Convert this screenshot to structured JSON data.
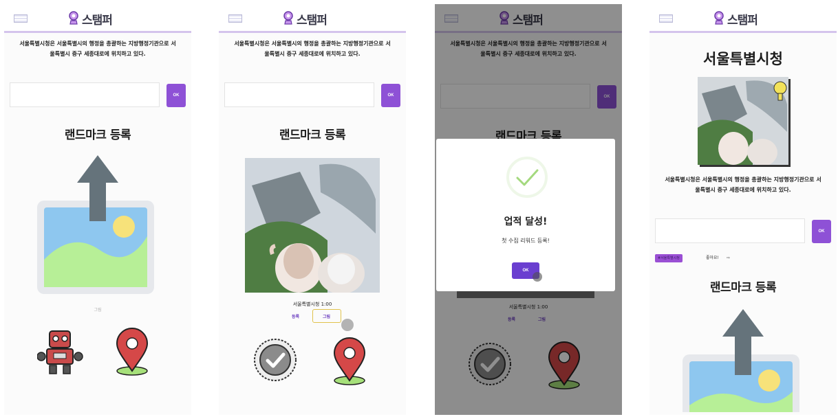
{
  "app": {
    "logo_text": "스탬퍼"
  },
  "common": {
    "description": "서울특별시청은 서울특별시의 행정을 총괄하는 지방행정기관으로 서울특별시 중구 세종대로에 위치하고 있다.",
    "ok_label": "OK",
    "register_title": "랜드마크 등록"
  },
  "screen1": {
    "caption": "그림"
  },
  "screen2": {
    "photo_label": "서울특별시청 1:00",
    "register_link": "등록",
    "retake_link": "그림"
  },
  "screen3": {
    "photo_label": "서울특별시청 1:00",
    "register_link": "등록",
    "retake_link": "그림",
    "modal": {
      "title": "업적 달성!",
      "message": "첫 수집 리워드 등록!",
      "ok_label": "OK"
    }
  },
  "screen4": {
    "landmark_name": "서울특별시청",
    "tag": "#서울특별시청",
    "like_label": "좋아요!",
    "like_arrow": "⇨"
  },
  "colors": {
    "accent": "#8e51d6",
    "header_line": "#d4c4ec"
  },
  "icons": [
    "menu-icon",
    "stamp-logo-icon",
    "upload-image-icon",
    "robot-icon",
    "map-pin-icon",
    "stamp-check-icon",
    "success-check-icon"
  ]
}
